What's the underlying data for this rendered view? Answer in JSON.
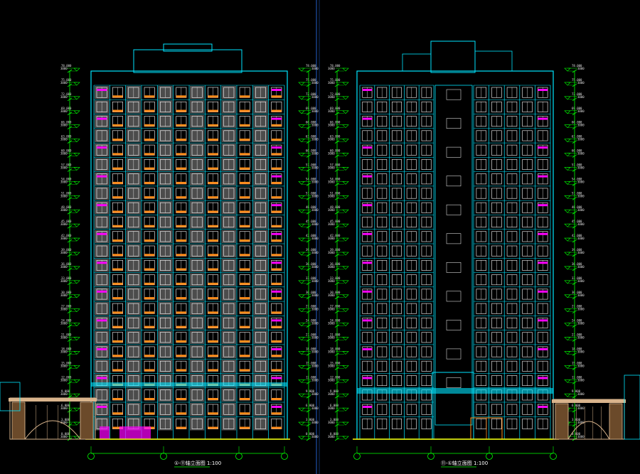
{
  "colors": {
    "background": "#000000",
    "outline": "#00e5ff",
    "dimension": "#00ff00",
    "highlight_magenta": "#ff00ff",
    "highlight_orange": "#ff8c1a",
    "wall_grey": "#8a8a8a",
    "window_white": "#ffffff",
    "gate_tan": "#d9b48c",
    "ground_yellow": "#ffff00",
    "divider": "#1e4fa8"
  },
  "icons": [
    "axis-bubble-icon",
    "elevation-marker-icon"
  ],
  "drawings": [
    {
      "id": "left",
      "title": "①-⑪轴立面图 1:100",
      "floors": 24
    },
    {
      "id": "right",
      "title": "⑪-①轴立面图 1:100",
      "floors": 24
    }
  ]
}
